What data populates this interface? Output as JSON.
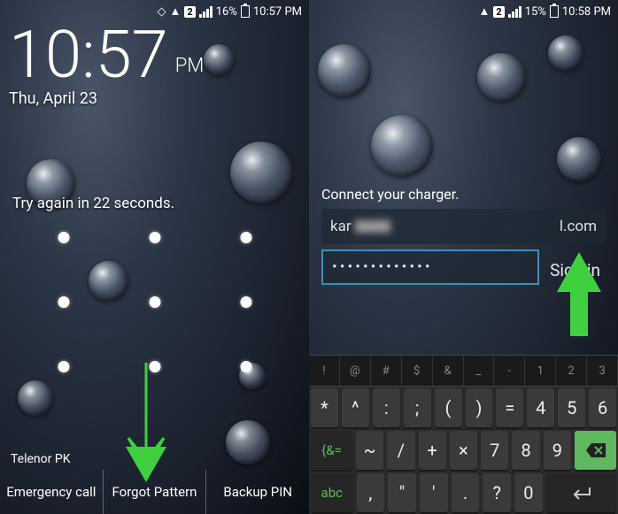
{
  "left": {
    "status": {
      "sim": "2",
      "battery": "16%",
      "time": "10:57 PM"
    },
    "clock": {
      "time": "10:57",
      "ampm": "PM",
      "date": "Thu, April 23"
    },
    "tryagain": "Try again in 22 seconds.",
    "carrier": "Telenor PK",
    "buttons": {
      "emergency": "Emergency call",
      "forgot": "Forgot Pattern",
      "backup": "Backup PIN"
    }
  },
  "right": {
    "status": {
      "sim": "2",
      "battery": "15%",
      "time": "10:58 PM"
    },
    "connect": "Connect your charger.",
    "login": {
      "email_prefix": "kar",
      "email_suffix": "l.com",
      "password": "•••••••••••••",
      "signin": "Sign in"
    },
    "symrow": [
      "!",
      "@",
      "#",
      "$",
      "&",
      "_",
      "-",
      "1",
      "2",
      "3"
    ],
    "keys": {
      "r1": [
        "*",
        "^",
        ":",
        ";",
        "(",
        ")",
        "=",
        "4",
        "5",
        "6"
      ],
      "r2_left": "{&=",
      "r2_mid": [
        "~",
        "/",
        "+",
        "×"
      ],
      "r2_right": [
        "7",
        "8",
        "9"
      ],
      "r3_left": "abc",
      "r3_mid": [
        ",",
        "\"",
        "'",
        ".",
        "?"
      ],
      "r3_right": "0"
    }
  }
}
